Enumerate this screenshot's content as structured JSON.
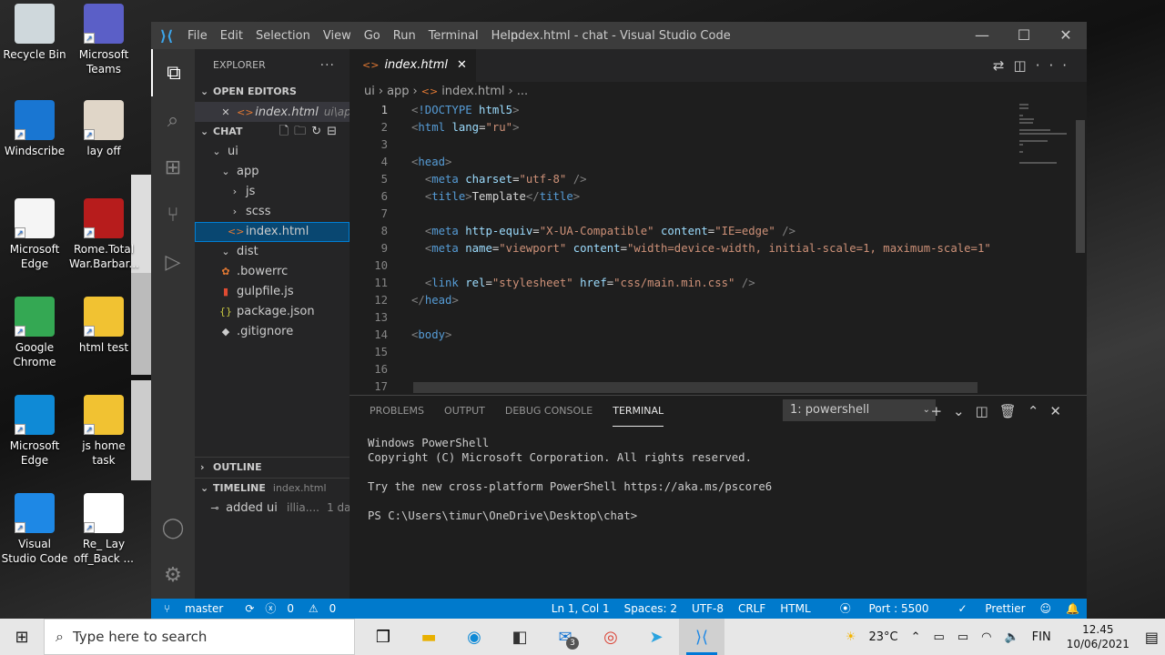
{
  "desktop": {
    "icons": [
      {
        "label": "Recycle Bin",
        "color": "#cfd8dc"
      },
      {
        "label": "Microsoft Teams",
        "color": "#5b5fc7"
      },
      {
        "label": "Windscribe",
        "color": "#1976d2"
      },
      {
        "label": "lay off",
        "color": "#e0d6c8"
      },
      {
        "label": "Microsoft Edge",
        "color": "#f5f5f5"
      },
      {
        "label": "Rome.Total War.Barbar...",
        "color": "#b71c1c"
      },
      {
        "label": "Google Chrome",
        "color": "#34a853"
      },
      {
        "label": "html test",
        "color": "#f1c232"
      },
      {
        "label": "Microsoft Edge",
        "color": "#0f8ad6"
      },
      {
        "label": "js home task",
        "color": "#f1c232"
      },
      {
        "label": "Visual Studio Code",
        "color": "#1e88e5"
      },
      {
        "label": "Re_ Lay off_Back ...",
        "color": "#ffffff"
      }
    ]
  },
  "window": {
    "title": "index.html - chat - Visual Studio Code",
    "menu": [
      "File",
      "Edit",
      "Selection",
      "View",
      "Go",
      "Run",
      "Terminal",
      "Help"
    ]
  },
  "sidebar": {
    "title": "EXPLORER",
    "open_editors_label": "OPEN EDITORS",
    "open_editor": {
      "name": "index.html",
      "path": "ui\\app"
    },
    "project_label": "CHAT",
    "tree": [
      {
        "label": "ui",
        "indent": 1,
        "icon": "chevron-down",
        "type": "folder"
      },
      {
        "label": "app",
        "indent": 2,
        "icon": "chevron-down",
        "type": "folder"
      },
      {
        "label": "js",
        "indent": 3,
        "icon": "chevron-right",
        "type": "folder"
      },
      {
        "label": "scss",
        "indent": 3,
        "icon": "chevron-right",
        "type": "folder"
      },
      {
        "label": "index.html",
        "indent": 3,
        "icon": "html",
        "type": "file",
        "selected": true
      },
      {
        "label": "dist",
        "indent": 2,
        "icon": "chevron-down",
        "type": "folder"
      },
      {
        "label": ".bowerrc",
        "indent": 2,
        "icon": "bower",
        "type": "file"
      },
      {
        "label": "gulpfile.js",
        "indent": 2,
        "icon": "gulp",
        "type": "file"
      },
      {
        "label": "package.json",
        "indent": 2,
        "icon": "json",
        "type": "file"
      },
      {
        "label": ".gitignore",
        "indent": 2,
        "icon": "git",
        "type": "file"
      }
    ],
    "outline_label": "OUTLINE",
    "timeline_label": "TIMELINE",
    "timeline_file": "index.html",
    "timeline_entry": {
      "text": "added ui",
      "author": "illia....",
      "time": "1 day"
    }
  },
  "editor": {
    "tab": "index.html",
    "breadcrumb": [
      "ui",
      "app",
      "index.html",
      "..."
    ],
    "lines": [
      {
        "n": "1",
        "t": "<!DOCTYPE html5>"
      },
      {
        "n": "2",
        "t": "<html lang=\"ru\">"
      },
      {
        "n": "3",
        "t": ""
      },
      {
        "n": "4",
        "t": "<head>"
      },
      {
        "n": "5",
        "t": "  <meta charset=\"utf-8\" />"
      },
      {
        "n": "6",
        "t": "  <title>Template</title>"
      },
      {
        "n": "7",
        "t": ""
      },
      {
        "n": "8",
        "t": "  <meta http-equiv=\"X-UA-Compatible\" content=\"IE=edge\" />"
      },
      {
        "n": "9",
        "t": "  <meta name=\"viewport\" content=\"width=device-width, initial-scale=1, maximum-scale=1\""
      },
      {
        "n": "10",
        "t": ""
      },
      {
        "n": "11",
        "t": "  <link rel=\"stylesheet\" href=\"css/main.min.css\" />"
      },
      {
        "n": "12",
        "t": "</head>"
      },
      {
        "n": "13",
        "t": ""
      },
      {
        "n": "14",
        "t": "<body>"
      },
      {
        "n": "15",
        "t": ""
      },
      {
        "n": "16",
        "t": ""
      },
      {
        "n": "17",
        "t": "  <!-- ========================================================= -->"
      }
    ]
  },
  "panel": {
    "tabs": [
      "PROBLEMS",
      "OUTPUT",
      "DEBUG CONSOLE",
      "TERMINAL"
    ],
    "active_tab": "TERMINAL",
    "shell_select": "1: powershell",
    "terminal_lines": [
      "Windows PowerShell",
      "Copyright (C) Microsoft Corporation. All rights reserved.",
      "",
      "Try the new cross-platform PowerShell https://aka.ms/pscore6",
      "",
      "PS C:\\Users\\timur\\OneDrive\\Desktop\\chat>"
    ]
  },
  "status": {
    "branch": "master",
    "errors": "0",
    "warnings": "0",
    "position": "Ln 1, Col 1",
    "spaces": "Spaces: 2",
    "encoding": "UTF-8",
    "eol": "CRLF",
    "language": "HTML",
    "port": "Port : 5500",
    "prettier": "Prettier"
  },
  "taskbar": {
    "search_placeholder": "Type here to search",
    "mail_badge": "3",
    "temperature": "23°C",
    "language": "FIN",
    "time": "12.45",
    "date": "10/06/2021"
  }
}
